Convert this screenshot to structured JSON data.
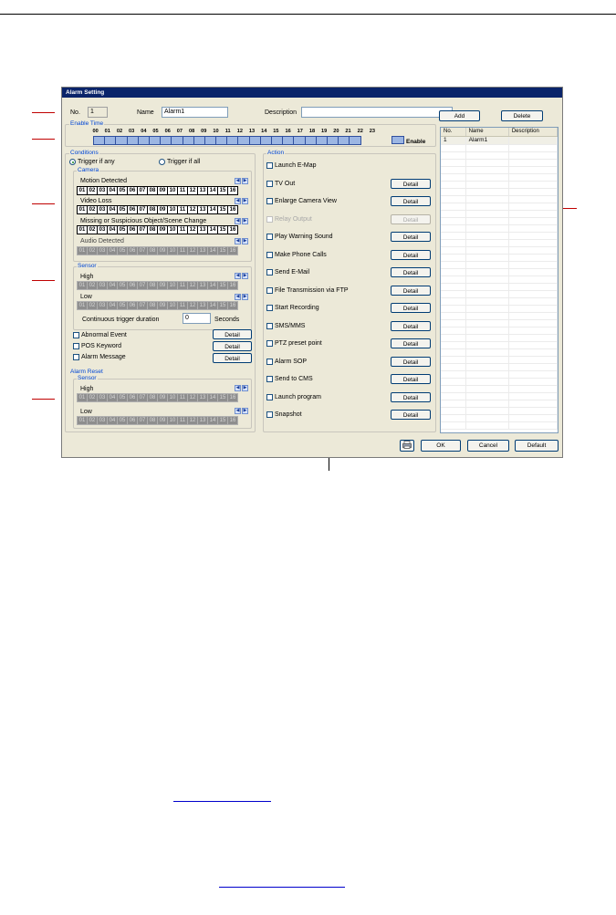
{
  "window": {
    "title": "Alarm Setting"
  },
  "header": {
    "no_label": "No.",
    "no_value": "1",
    "name_label": "Name",
    "name_value": "Alarm1",
    "description_label": "Description",
    "description_value": "",
    "add_label": "Add",
    "delete_label": "Delete"
  },
  "enable_time": {
    "title": "Enable Time",
    "hours": [
      "00",
      "01",
      "02",
      "03",
      "04",
      "05",
      "06",
      "07",
      "08",
      "09",
      "10",
      "11",
      "12",
      "13",
      "14",
      "15",
      "16",
      "17",
      "18",
      "19",
      "20",
      "21",
      "22",
      "23"
    ],
    "enable_label": "Enable"
  },
  "conditions": {
    "title": "Conditions",
    "trigger_any": "Trigger if any",
    "trigger_all": "Trigger if all",
    "camera_title": "Camera",
    "motion_label": "Motion Detected",
    "video_loss_label": "Video Loss",
    "missing_label": "Missing or Suspicious Object/Scene Change",
    "audio_label": "Audio Detected",
    "channels": [
      "01",
      "02",
      "03",
      "04",
      "05",
      "06",
      "07",
      "08",
      "09",
      "10",
      "11",
      "12",
      "13",
      "14",
      "15",
      "16"
    ],
    "sensor_title": "Sensor",
    "high_label": "High",
    "low_label": "Low",
    "duration_label": "Continuous trigger duration",
    "duration_value": "0",
    "seconds_label": "Seconds",
    "abnormal_label": "Abnormal Event",
    "pos_label": "POS Keyword",
    "alarm_msg_label": "Alarm Message",
    "detail_label": "Detail"
  },
  "alarm_reset": {
    "title": "Alarm Reset",
    "sensor_title": "Sensor",
    "high_label": "High",
    "low_label": "Low"
  },
  "action": {
    "title": "Action",
    "items": [
      {
        "label": "Launch E-Map",
        "has_detail": false,
        "disabled": false
      },
      {
        "label": "TV Out",
        "has_detail": true,
        "disabled": false
      },
      {
        "label": "Enlarge Camera View",
        "has_detail": true,
        "disabled": false
      },
      {
        "label": "Relay Output",
        "has_detail": true,
        "disabled": true
      },
      {
        "label": "Play Warning Sound",
        "has_detail": true,
        "disabled": false
      },
      {
        "label": "Make Phone Calls",
        "has_detail": true,
        "disabled": false
      },
      {
        "label": "Send E-Mail",
        "has_detail": true,
        "disabled": false
      },
      {
        "label": "File Transmission via FTP",
        "has_detail": true,
        "disabled": false
      },
      {
        "label": "Start Recording",
        "has_detail": true,
        "disabled": false
      },
      {
        "label": "SMS/MMS",
        "has_detail": true,
        "disabled": false
      },
      {
        "label": "PTZ preset point",
        "has_detail": true,
        "disabled": false
      },
      {
        "label": "Alarm SOP",
        "has_detail": true,
        "disabled": false
      },
      {
        "label": "Send to CMS",
        "has_detail": true,
        "disabled": false
      },
      {
        "label": "Launch program",
        "has_detail": true,
        "disabled": false
      },
      {
        "label": "Snapshot",
        "has_detail": true,
        "disabled": false
      }
    ],
    "detail_label": "Detail"
  },
  "alarm_list": {
    "columns": [
      "No.",
      "Name",
      "Description"
    ],
    "rows": [
      {
        "no": "1",
        "name": "Alarm1",
        "description": ""
      }
    ]
  },
  "footer": {
    "ok_label": "OK",
    "cancel_label": "Cancel",
    "default_label": "Default"
  },
  "colors": {
    "callout": "#c00000",
    "title_bar": "#0a246a",
    "hour_cell": "#9cb6e3"
  },
  "icons": {
    "footer_icon": "printer-icon"
  }
}
